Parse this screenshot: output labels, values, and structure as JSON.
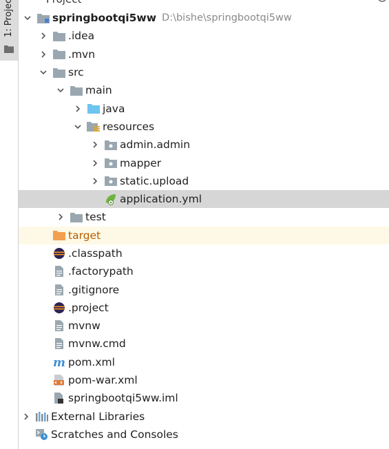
{
  "panel": {
    "side_label": "1: Project",
    "tab_title": "Project"
  },
  "tree": {
    "root": {
      "label": "springbootqi5ww",
      "path": "D:\\bishe\\springbootqi5ww"
    },
    "idea": "idea",
    "mvn": "mvn",
    "src": "src",
    "main": "main",
    "java": "java",
    "resources": "resources",
    "admin": "admin.admin",
    "mapper": "mapper",
    "static": "static.upload",
    "application": "application.yml",
    "test": "test",
    "target": "target",
    "classpath": ".classpath",
    "factorypath": ".factorypath",
    "gitignore": ".gitignore",
    "project": ".project",
    "mvnw": "mvnw",
    "mvnwcmd": "mvnw.cmd",
    "pom": "pom.xml",
    "pomwar": "pom-war.xml",
    "iml": "springbootqi5ww.iml",
    "external": "External Libraries",
    "scratches": "Scratches and Consoles"
  },
  "colors": {
    "folder": "#9aa7b0",
    "java_folder": "#6ec3ef",
    "target_folder": "#f2a04f",
    "selection": "#d6d6d6",
    "highlight": "#fdf9e6"
  }
}
